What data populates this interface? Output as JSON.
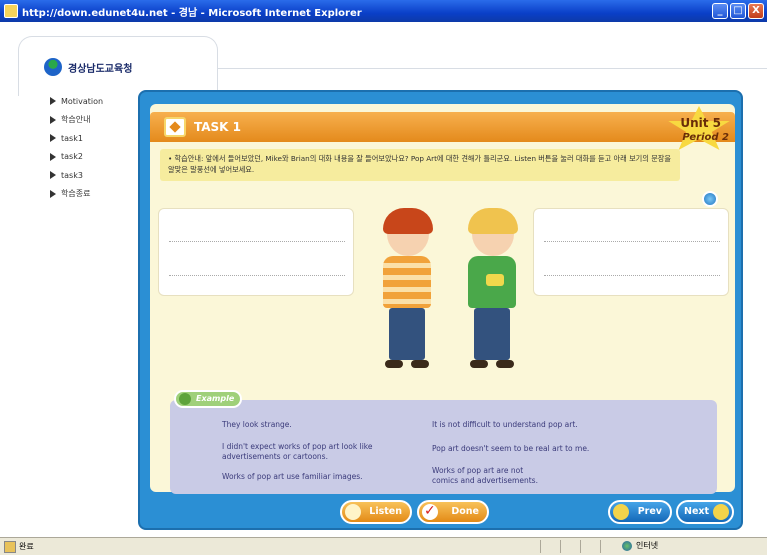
{
  "window": {
    "title": "http://down.edunet4u.net - 경남 - Microsoft Internet Explorer",
    "buttons": {
      "minimize": "_",
      "maximize": "□",
      "close": "X"
    }
  },
  "site": {
    "logo_text": "경상남도교육청"
  },
  "nav": {
    "items": [
      {
        "label": "Motivation"
      },
      {
        "label": "학습안내"
      },
      {
        "label": "task1"
      },
      {
        "label": "task2"
      },
      {
        "label": "task3"
      },
      {
        "label": "학습종료"
      }
    ]
  },
  "task": {
    "title": "TASK 1",
    "unit": "Unit 5",
    "period": "Period 2",
    "instruction": "• 학습안내: 앞에서 들어보았던, Mike와 Brian의 대화 내용을 잘 들어보았나요? Pop Art에 대한 견해가 틀리군요. Listen 버튼을 눌러 대화를 듣고 아래 보기의 문장을 알맞은 말풍선에 넣어보세요."
  },
  "example": {
    "tag": "Example",
    "items_left": [
      "They look strange.",
      "I didn't expect works of pop art look like advertisements or cartoons.",
      "Works of pop art use familiar images."
    ],
    "items_right": [
      "It is not difficult to understand pop art.",
      "Pop art doesn't seem to be real art to me.",
      "Works of pop art are not comics and advertisements."
    ]
  },
  "buttons": {
    "listen": "Listen",
    "done": "Done",
    "prev": "Prev",
    "next": "Next"
  },
  "status": {
    "left": "완료",
    "zone": "인터넷"
  }
}
